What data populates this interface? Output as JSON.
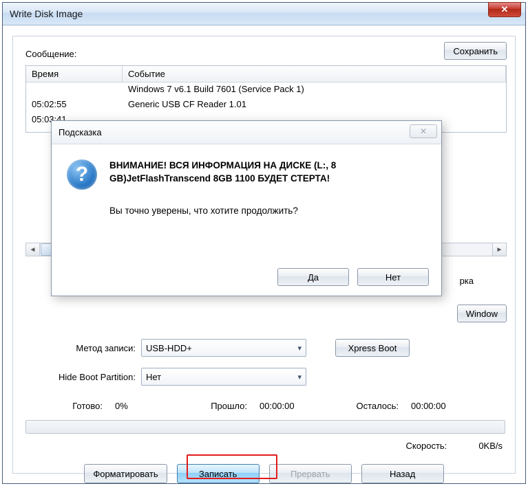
{
  "window": {
    "title": "Write Disk Image"
  },
  "labels": {
    "message": "Сообщение:",
    "save": "Сохранить",
    "col_time": "Время",
    "col_event": "Событие",
    "method": "Метод записи:",
    "hide": "Hide Boot Partition:",
    "xpress": "Xpress Boot",
    "chk": "рка",
    "winsuffix": "Window",
    "ready": "Готово:",
    "elapsed": "Прошло:",
    "remaining": "Осталось:",
    "speed": "Скорость:"
  },
  "log": [
    {
      "time": "",
      "event": "Windows 7 v6.1 Build 7601 (Service Pack 1)"
    },
    {
      "time": "05:02:55",
      "event": "Generic USB CF Reader   1.01"
    },
    {
      "time": "05:03:41",
      "event": ""
    }
  ],
  "combo": {
    "method": "USB-HDD+",
    "hide": "Нет"
  },
  "status": {
    "ready": "0%",
    "elapsed": "00:00:00",
    "remaining": "00:00:00",
    "speed": "0KB/s"
  },
  "buttons": {
    "format": "Форматировать",
    "write": "Записать",
    "abort": "Прервать",
    "back": "Назад"
  },
  "dialog": {
    "title": "Подсказка",
    "warn1": "ВНИМАНИЕ! ВСЯ ИНФОРМАЦИЯ НА ДИСКЕ (L:, 8",
    "warn2": "GB)JetFlashTranscend 8GB   1100 БУДЕТ СТЕРТА!",
    "question": "Вы точно уверены, что хотите продолжить?",
    "yes": "Да",
    "no": "Нет"
  }
}
